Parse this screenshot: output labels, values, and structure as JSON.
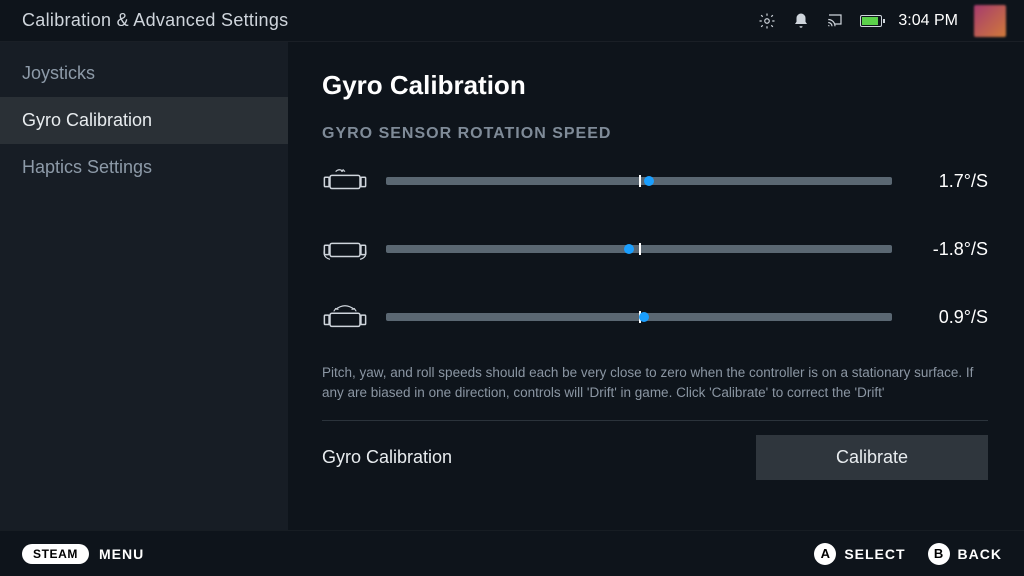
{
  "header": {
    "title": "Calibration & Advanced Settings",
    "time": "3:04 PM"
  },
  "sidebar": {
    "items": [
      {
        "label": "Joysticks"
      },
      {
        "label": "Gyro Calibration"
      },
      {
        "label": "Haptics Settings"
      }
    ],
    "activeIndex": 1
  },
  "main": {
    "title": "Gyro Calibration",
    "section": "GYRO SENSOR ROTATION SPEED",
    "axes": [
      {
        "axis": "pitch",
        "valueText": "1.7°/S",
        "thumbPercent": 52
      },
      {
        "axis": "roll",
        "valueText": "-1.8°/S",
        "thumbPercent": 48
      },
      {
        "axis": "yaw",
        "valueText": "0.9°/S",
        "thumbPercent": 51
      }
    ],
    "description": "Pitch, yaw, and roll speeds should each be very close to zero when the controller is on a stationary surface. If any are biased in one direction, controls will 'Drift' in game. Click 'Calibrate' to correct the 'Drift'",
    "calibration": {
      "label": "Gyro Calibration",
      "button": "Calibrate"
    }
  },
  "footer": {
    "steam": "STEAM",
    "menu": "MENU",
    "hints": [
      {
        "key": "A",
        "label": "SELECT"
      },
      {
        "key": "B",
        "label": "BACK"
      }
    ]
  }
}
